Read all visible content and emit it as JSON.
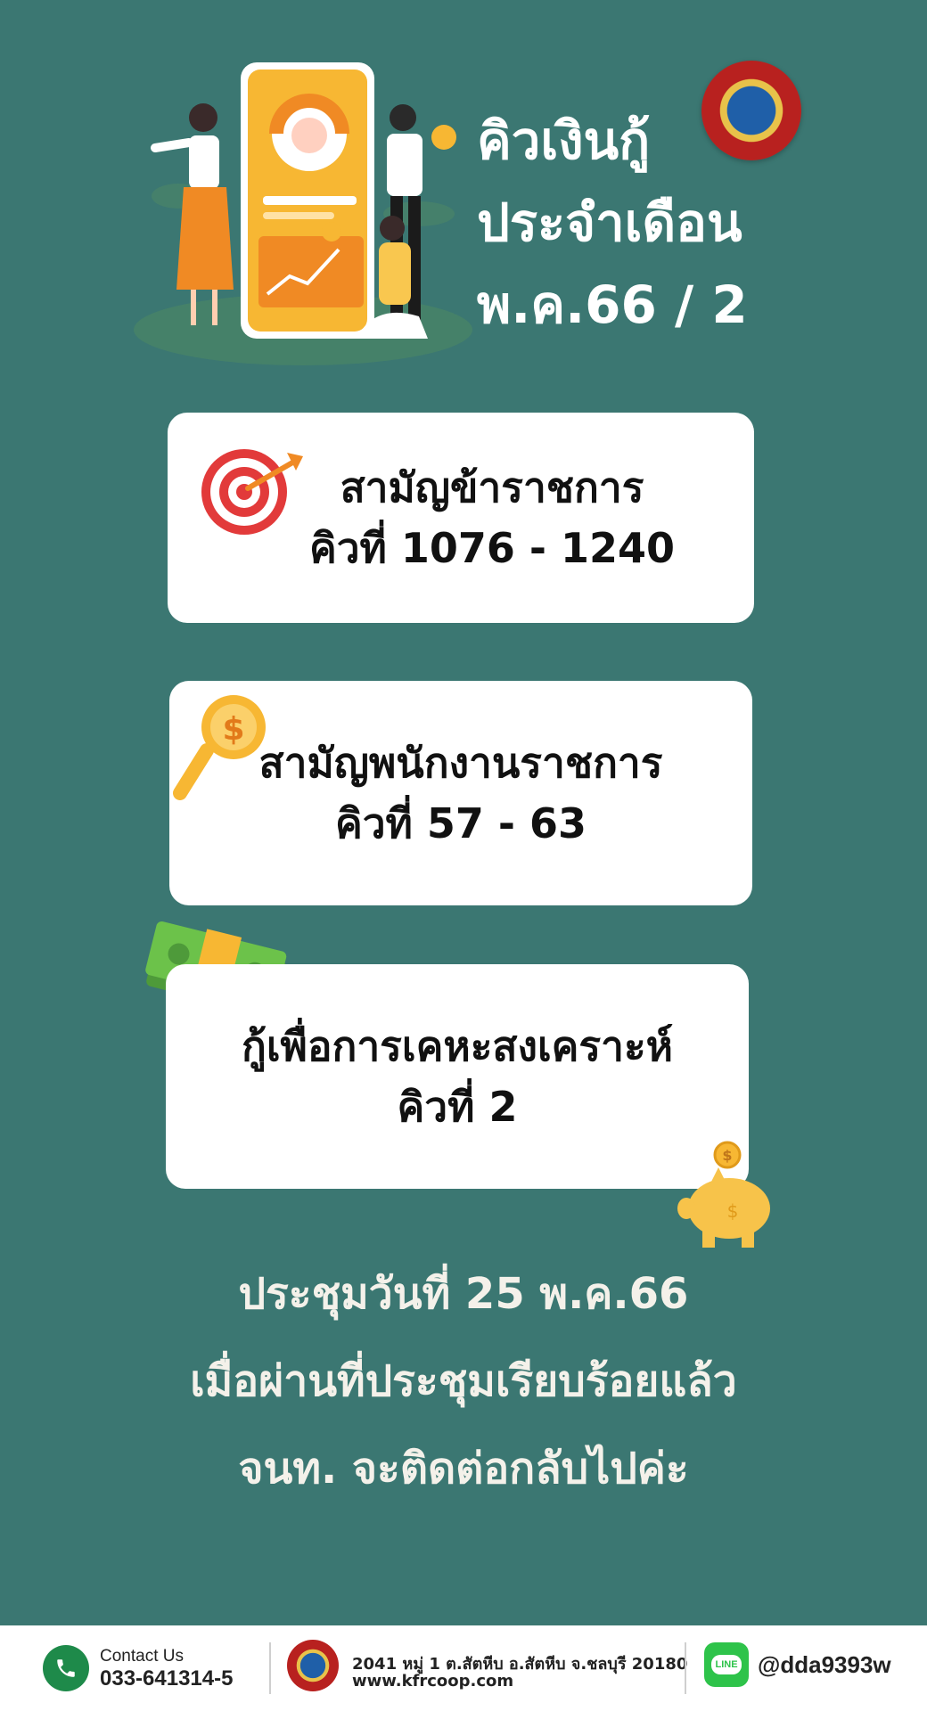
{
  "header": {
    "title_lines": [
      "คิวเงินกู้",
      "ประจำเดือน",
      "พ.ค.66 / 2"
    ]
  },
  "cards": [
    {
      "category": "สามัญข้าราชการ",
      "queue": "คิวที่ 1076 - 1240"
    },
    {
      "category": "สามัญพนักงานราชการ",
      "queue": "คิวที่ 57 - 63"
    },
    {
      "category": "กู้เพื่อการเคหะสงเคราะห์",
      "queue": "คิวที่ 2"
    }
  ],
  "message": {
    "lines": [
      "ประชุมวันที่ 25 พ.ค.66",
      "เมื่อผ่านที่ประชุมเรียบร้อยแล้ว",
      "จนท. จะติดต่อกลับไปค่ะ"
    ]
  },
  "footer": {
    "contact_label": "Contact Us",
    "contact_phone": "033-641314-5",
    "address": "2041 หมู่ 1 ต.สัตหีบ อ.สัตหีบ จ.ชลบุรี 20180",
    "website": "www.kfrcoop.com",
    "line_badge": "LINE",
    "line_id": "@dda9393w"
  },
  "colors": {
    "background": "#3b7772",
    "card": "#ffffff",
    "message_text": "#f4f1ea",
    "accent_yellow": "#f7b733",
    "line_green": "#2ec34a",
    "phone_green": "#1e8a4a"
  },
  "icons": [
    "target-icon",
    "magnifier-dollar-icon",
    "money-stack-icon",
    "piggy-bank-icon",
    "phone-icon",
    "line-icon",
    "coop-seal-logo",
    "finance-team-illustration"
  ]
}
